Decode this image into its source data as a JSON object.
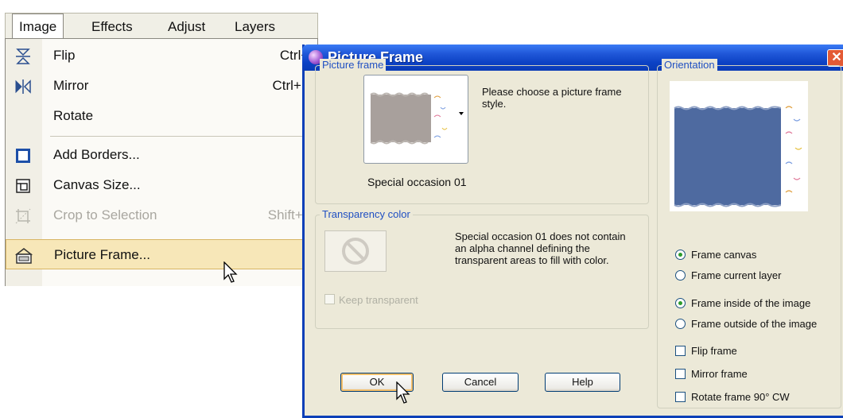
{
  "menubar": {
    "items": [
      "Image",
      "Effects",
      "Adjust",
      "Layers"
    ]
  },
  "menu": {
    "items": [
      {
        "label": "Flip",
        "shortcut": "Ctrl+I",
        "icon": "flip-icon"
      },
      {
        "label": "Mirror",
        "shortcut": "Ctrl+M",
        "icon": "mirror-icon"
      },
      {
        "label": "Rotate",
        "shortcut": "",
        "icon": ""
      },
      {
        "label": "Add Borders...",
        "shortcut": "",
        "icon": "add-borders-icon"
      },
      {
        "label": "Canvas Size...",
        "shortcut": "",
        "icon": "canvas-size-icon"
      },
      {
        "label": "Crop to Selection",
        "shortcut": "Shift+R",
        "icon": "crop-icon",
        "disabled": true
      },
      {
        "label": "Picture Frame...",
        "shortcut": "",
        "icon": "picture-frame-icon",
        "highlighted": true
      }
    ]
  },
  "dialog": {
    "title": "Picture Frame",
    "picture_frame": {
      "group_title": "Picture frame",
      "hint": "Please choose a picture frame style.",
      "selected_frame": "Special occasion 01"
    },
    "transparency": {
      "group_title": "Transparency color",
      "message": "Special occasion 01 does not contain an alpha channel defining the transparent areas to fill with color.",
      "keep_transparent_label": "Keep transparent"
    },
    "orientation": {
      "group_title": "Orientation",
      "frame_target": {
        "options": [
          "Frame canvas",
          "Frame current layer"
        ],
        "selected": "Frame canvas"
      },
      "frame_position": {
        "options": [
          "Frame inside of the image",
          "Frame outside of the image"
        ],
        "selected": "Frame inside of the image"
      },
      "checkboxes": [
        {
          "label": "Flip frame",
          "checked": false
        },
        {
          "label": "Mirror frame",
          "checked": false
        },
        {
          "label": "Rotate frame 90° CW",
          "checked": false
        }
      ]
    },
    "buttons": {
      "ok": "OK",
      "cancel": "Cancel",
      "help": "Help"
    }
  },
  "colors": {
    "titlebar": "#0a3fb8",
    "dialog_bg": "#ece9d8",
    "menu_highlight": "#f7e7b8",
    "preview_fill": "#4e6aa0",
    "frame_gray": "#a8a09c",
    "group_title": "#1f4fc2"
  }
}
